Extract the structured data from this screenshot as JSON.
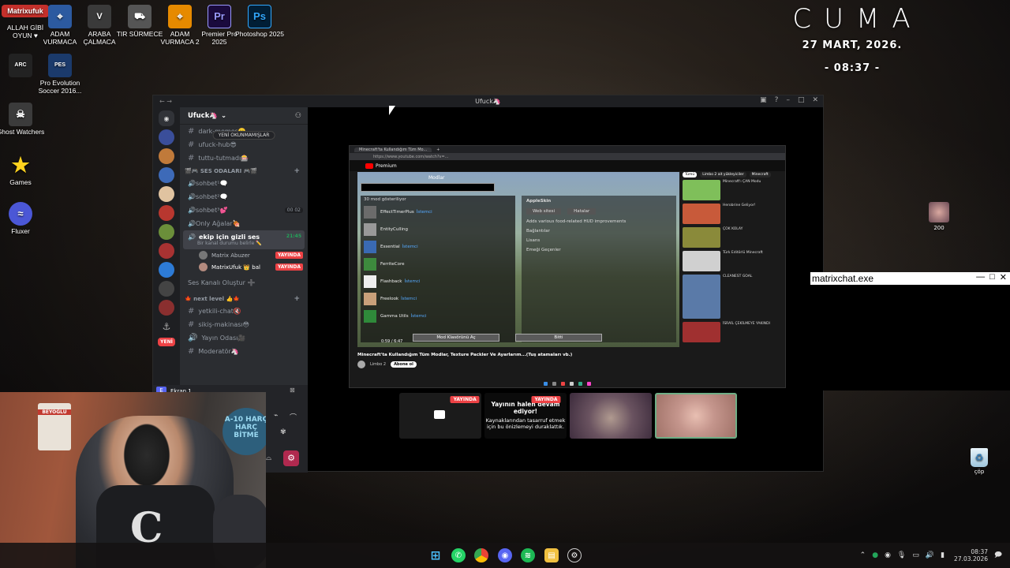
{
  "desktop": {
    "icons": [
      {
        "label": "ALLAH GİBİ OYUN ♥",
        "badge": "Matrixufuk"
      },
      {
        "label": "ADAM VURMACA"
      },
      {
        "label": "ARABA ÇALMACA"
      },
      {
        "label": "TIR SÜRMECE"
      },
      {
        "label": "ADAM VURMACA 2"
      },
      {
        "label": "Premier Pro 2025",
        "glyph": "Pr"
      },
      {
        "label": "Photoshop 2025",
        "glyph": "Ps"
      },
      {
        "label": "Pro Evolution Soccer 2016..."
      },
      {
        "label": "Ghost Watchers"
      },
      {
        "label": "Games"
      },
      {
        "label": "Fluxer"
      }
    ],
    "clock_widget": {
      "day": "CUMA",
      "date": "27 MART, 2026.",
      "time": "- 08:37 -"
    },
    "right_avatar_label": "200",
    "recycle_bin_label": "çöp"
  },
  "discord": {
    "window_title": "Ufuck🦄",
    "server_name": "Ufuck🦄",
    "unread_badge": "YENİ OKUNMAMIŞLAR",
    "channels": [
      {
        "name": "dark-memes🤫"
      },
      {
        "name": "ufuck-hub😎"
      },
      {
        "name": "tuttu-tutmadı🎰"
      }
    ],
    "voice_category": "🎬🎮 SES ODALARI 🎮🎬",
    "voice_channels": [
      {
        "name": "🔊sohbet¹🗨️"
      },
      {
        "name": "🔊sohbet²🗨️"
      },
      {
        "name": "🔊sohbet³💕",
        "counts": [
          "00",
          "02"
        ]
      },
      {
        "name": "🔊Only Ağalar🍖"
      }
    ],
    "active_channel": {
      "name": "ekip için gizli ses",
      "time": "21:45",
      "status": "Bir kanal durumu belirle ✏️"
    },
    "members": [
      {
        "name": "Matrix Abuzer",
        "live": "YAYINDA"
      },
      {
        "name": "MatrixUfuk 👑 bal",
        "live": "YAYINDA"
      }
    ],
    "create_voice": "Ses Kanalı Oluştur ➕",
    "text_category": "🍁 next level 👍🍁",
    "text_channels": [
      {
        "name": "yetkili-chat🔇"
      },
      {
        "name": "sikiş-makinası😳"
      },
      {
        "name": "Yayın Odası🎥"
      },
      {
        "name": "Moderatör🦄"
      }
    ],
    "guild_new_label": "YENİ",
    "screen_label": "Ekran 1",
    "stream": {
      "browser_tab": "Minecraft'ta Kullandığım Tüm Mo...",
      "url": "https://www.youtube.com/watch?v=...",
      "yt_logo": "Premium",
      "mc_title": "Modlar",
      "mod_count": "30 mod gösteriliyor",
      "mods": [
        {
          "name": "EffectTimerPlus",
          "tag": "İstemci"
        },
        {
          "name": "EntityCulling",
          "tag": ""
        },
        {
          "name": "Essential",
          "tag": "İstemci"
        },
        {
          "name": "FerriteCore",
          "tag": ""
        },
        {
          "name": "Flashback",
          "tag": "İstemci"
        },
        {
          "name": "Freelook",
          "tag": "İstemci"
        },
        {
          "name": "Gamma Utils",
          "tag": "İstemci"
        }
      ],
      "right_panel": {
        "mod": "AppleSkin",
        "web": "Web sitesi",
        "issues": "Hatalar",
        "desc": "Adds various food-related HUD improvements",
        "links": "Bağlantılar",
        "license": "Lisans",
        "credits": "Emeği Geçenler"
      },
      "mc_buttons": [
        "Mod Klasörünü Aç",
        "Bitti"
      ],
      "video_title": "Minecraft'ta Kullandığım Tüm Modlar, Texture Packler Ve Ayarlarım...(Tuş atamaları vb.)",
      "channel": "Limbo 2",
      "subscribe": "Abone ol",
      "time": "0:59 / 6:47",
      "chips": [
        "Tümü",
        "Limbo 2 ait yükleyiciler",
        "Minecraft"
      ]
    },
    "tiles": {
      "live1": "YAYINDA",
      "live2": "YAYINDA",
      "paused_title": "Yayının halen devam ediyor!",
      "paused_body": "Kaynaklarından tasarruf etmek için bu önizlemeyi duraklattık."
    }
  },
  "webcam": {
    "poster_text": "BEYOĞLU",
    "mic_text": "A-10 HARÇ HARÇ BİTME"
  },
  "matrixchat": {
    "title": "matrixchat.exe"
  },
  "taskbar": {
    "time": "08:37",
    "date": "27.03.2026"
  }
}
